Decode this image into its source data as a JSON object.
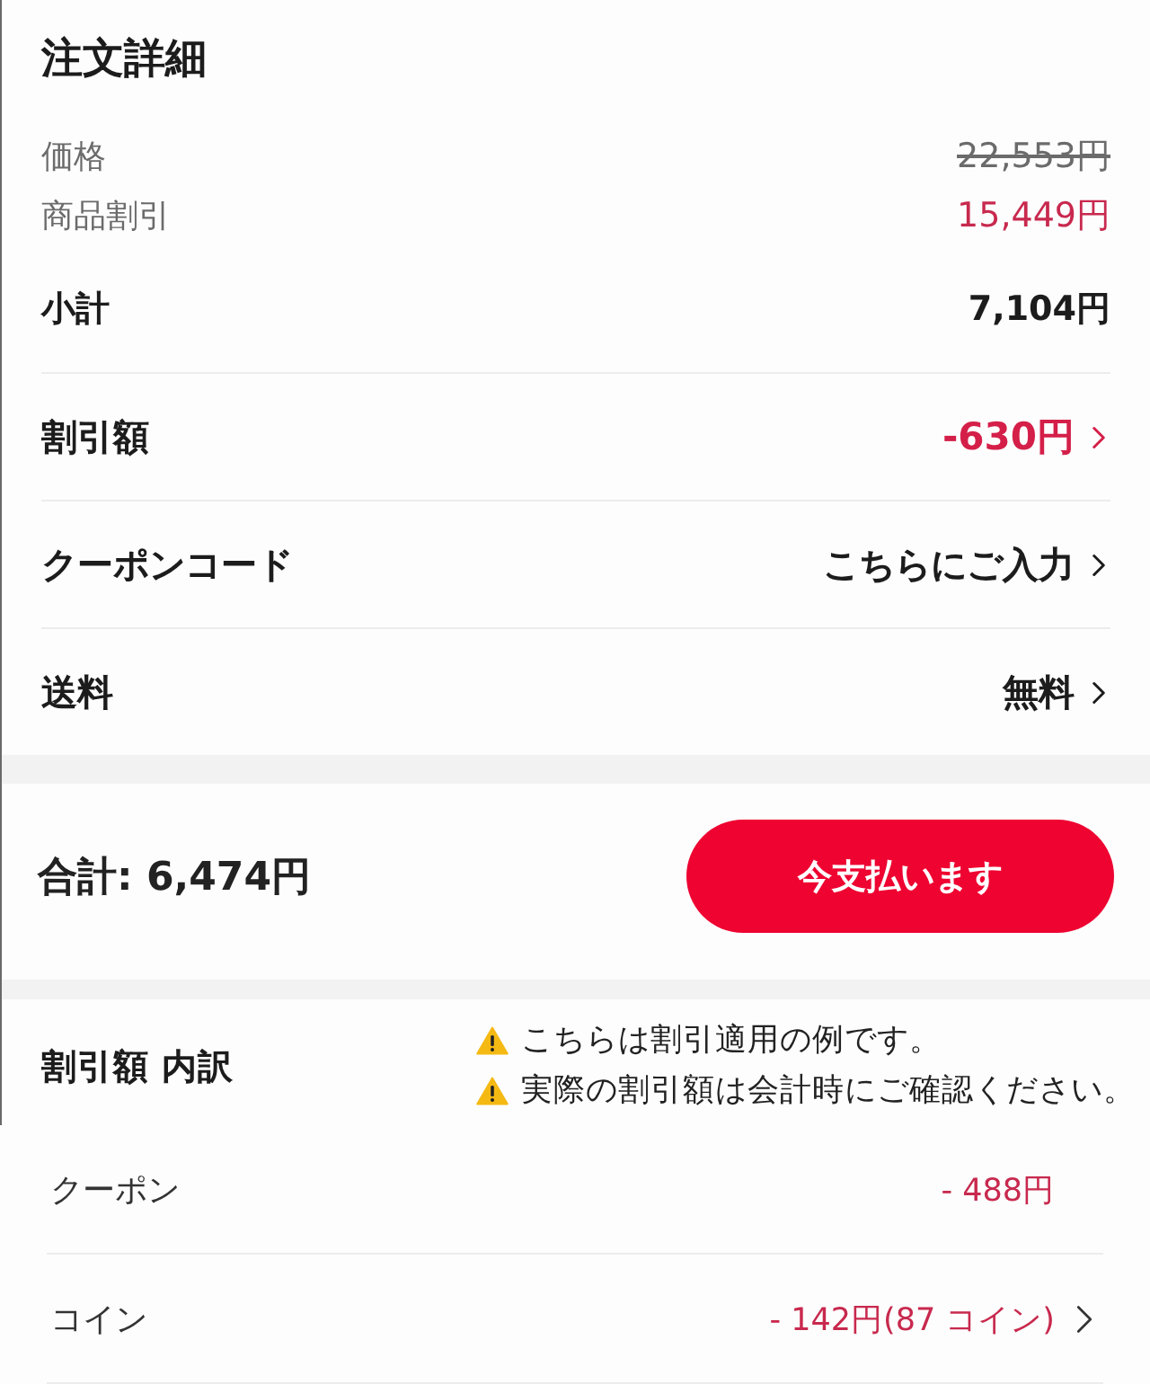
{
  "order_details": {
    "title": "注文詳細",
    "price_rows": [
      {
        "label": "価格",
        "value": "22,553円",
        "kind": "original"
      },
      {
        "label": "商品割引",
        "value": "15,449円",
        "kind": "discount"
      }
    ],
    "subtotal": {
      "label": "小計",
      "value": "7,104円"
    },
    "link_rows": [
      {
        "label": "割引額",
        "value": "-630円",
        "kind": "discount"
      },
      {
        "label": "クーポンコード",
        "value": "こちらにご入力",
        "kind": "plain"
      },
      {
        "label": "送料",
        "value": "無料",
        "kind": "plain"
      }
    ]
  },
  "checkout": {
    "total": "合計: 6,474円",
    "pay_button": "今支払います"
  },
  "breakdown": {
    "title": "割引額 内訳",
    "notes": [
      "こちらは割引適用の例です。",
      "実際の割引額は会計時にご確認ください。"
    ],
    "rows": [
      {
        "label": "クーポン",
        "value": "- 488円",
        "chevron": false
      },
      {
        "label": "コイン",
        "value": "- 142円(87 コイン)",
        "chevron": true
      }
    ]
  }
}
